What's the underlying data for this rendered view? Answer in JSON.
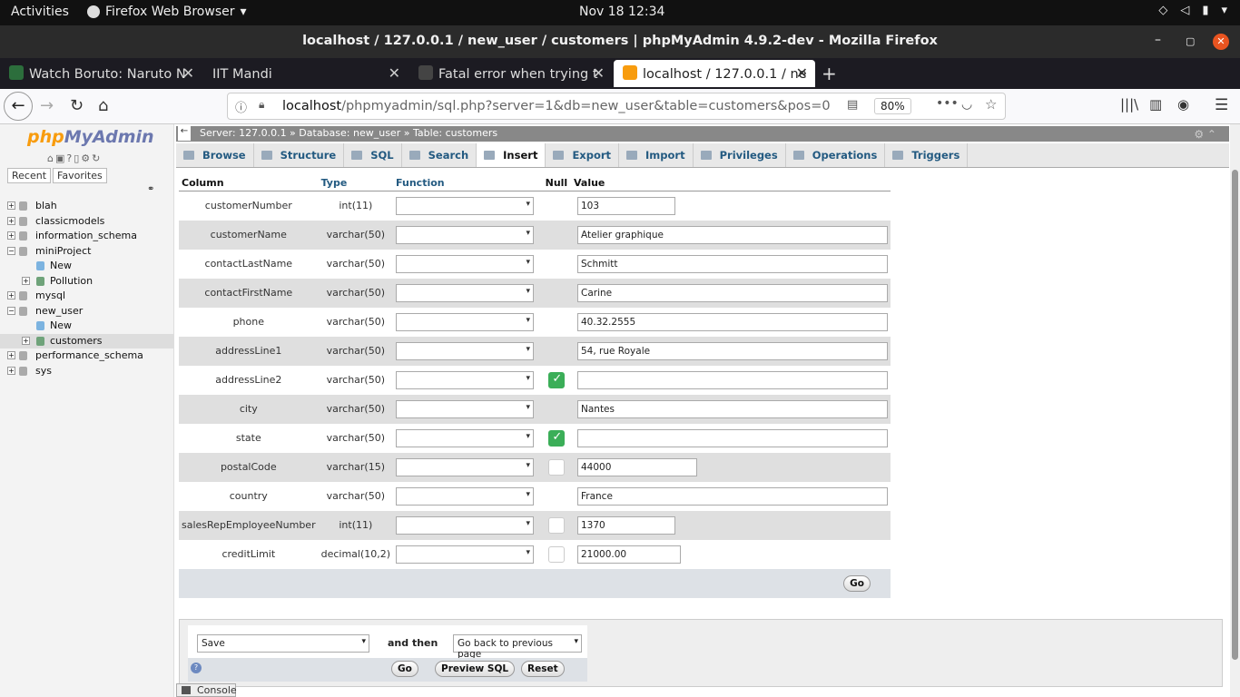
{
  "os": {
    "activities": "Activities",
    "app_name": "Firefox Web Browser",
    "clock": "Nov 18  12:34"
  },
  "window": {
    "title": "localhost / 127.0.0.1 / new_user / customers | phpMyAdmin 4.9.2-dev - Mozilla Firefox"
  },
  "tabs": [
    {
      "label": "Watch Boruto: Naruto N",
      "favicon_color": "#2c6e3c"
    },
    {
      "label": "IIT Mandi",
      "favicon_color": ""
    },
    {
      "label": "Fatal error when trying t",
      "favicon_color": "#444"
    },
    {
      "label": "localhost / 127.0.0.1 / ne",
      "favicon_color": "#f89c0e"
    }
  ],
  "url": {
    "host": "localhost",
    "path": "/phpmyadmin/sql.php?server=1&db=new_user&table=customers&pos=0",
    "zoom": "80%"
  },
  "pma": {
    "logo_a": "php",
    "logo_b": "MyAdmin",
    "sidetab_recent": "Recent",
    "sidetab_favorites": "Favorites",
    "tree": [
      {
        "label": "blah",
        "level": 0,
        "exp": "+"
      },
      {
        "label": "classicmodels",
        "level": 0,
        "exp": "+"
      },
      {
        "label": "information_schema",
        "level": 0,
        "exp": "+"
      },
      {
        "label": "miniProject",
        "level": 0,
        "exp": "−"
      },
      {
        "label": "New",
        "level": 1,
        "exp": ""
      },
      {
        "label": "Pollution",
        "level": 1,
        "exp": "+"
      },
      {
        "label": "mysql",
        "level": 0,
        "exp": "+"
      },
      {
        "label": "new_user",
        "level": 0,
        "exp": "−"
      },
      {
        "label": "New",
        "level": 1,
        "exp": ""
      },
      {
        "label": "customers",
        "level": 1,
        "exp": "+"
      },
      {
        "label": "performance_schema",
        "level": 0,
        "exp": "+"
      },
      {
        "label": "sys",
        "level": 0,
        "exp": "+"
      }
    ],
    "breadcrumb": {
      "server": "Server: 127.0.0.1",
      "database": "Database: new_user",
      "table": "Table: customers"
    },
    "menu": [
      "Browse",
      "Structure",
      "SQL",
      "Search",
      "Insert",
      "Export",
      "Import",
      "Privileges",
      "Operations",
      "Triggers"
    ],
    "active_menu": "Insert",
    "headers": {
      "column": "Column",
      "type": "Type",
      "function": "Function",
      "null": "Null",
      "value": "Value"
    },
    "rows": [
      {
        "column": "customerNumber",
        "type": "int(11)",
        "null": "none",
        "value": "103",
        "wide": false,
        "w": 108
      },
      {
        "column": "customerName",
        "type": "varchar(50)",
        "null": "none",
        "value": "Atelier graphique",
        "wide": true,
        "w": 342
      },
      {
        "column": "contactLastName",
        "type": "varchar(50)",
        "null": "none",
        "value": "Schmitt",
        "wide": true,
        "w": 342
      },
      {
        "column": "contactFirstName",
        "type": "varchar(50)",
        "null": "none",
        "value": "Carine",
        "wide": true,
        "w": 342
      },
      {
        "column": "phone",
        "type": "varchar(50)",
        "null": "none",
        "value": "40.32.2555",
        "wide": true,
        "w": 342
      },
      {
        "column": "addressLine1",
        "type": "varchar(50)",
        "null": "none",
        "value": "54, rue Royale",
        "wide": true,
        "w": 342
      },
      {
        "column": "addressLine2",
        "type": "varchar(50)",
        "null": "checked",
        "value": "",
        "wide": true,
        "w": 342
      },
      {
        "column": "city",
        "type": "varchar(50)",
        "null": "none",
        "value": "Nantes",
        "wide": true,
        "w": 342
      },
      {
        "column": "state",
        "type": "varchar(50)",
        "null": "checked",
        "value": "",
        "wide": true,
        "w": 342
      },
      {
        "column": "postalCode",
        "type": "varchar(15)",
        "null": "unchecked",
        "value": "44000",
        "wide": false,
        "w": 132
      },
      {
        "column": "country",
        "type": "varchar(50)",
        "null": "none",
        "value": "France",
        "wide": true,
        "w": 342
      },
      {
        "column": "salesRepEmployeeNumber",
        "type": "int(11)",
        "null": "unchecked",
        "value": "1370",
        "wide": false,
        "w": 108
      },
      {
        "column": "creditLimit",
        "type": "decimal(10,2)",
        "null": "unchecked",
        "value": "21000.00",
        "wide": false,
        "w": 114
      }
    ],
    "go_label": "Go",
    "bottom": {
      "action": "Save",
      "and_then": "and then",
      "after": "Go back to previous page",
      "go": "Go",
      "preview": "Preview SQL",
      "reset": "Reset"
    },
    "console": "Console"
  }
}
